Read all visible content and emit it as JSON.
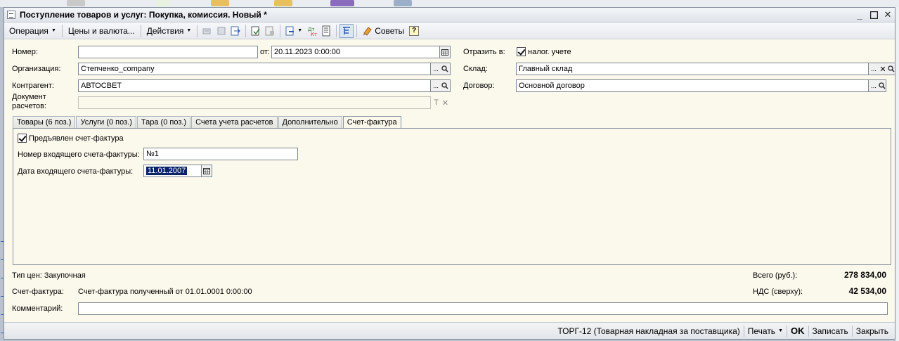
{
  "window": {
    "title": "Поступление товаров и услуг: Покупка, комиссия. Новый *"
  },
  "toolbar": {
    "operation_label": "Операция",
    "prices_label": "Цены и валюта...",
    "actions_label": "Действия",
    "tips_label": "Советы",
    "help_label": "?"
  },
  "header": {
    "number_label": "Номер:",
    "number_value": "",
    "from_label": "от:",
    "date_value": "20.11.2023  0:00:00",
    "reflect_label": "Отразить в:",
    "tax_label": "налог. учете",
    "org_label": "Организация:",
    "org_value": "Степченко_company",
    "warehouse_label": "Склад:",
    "warehouse_value": "Главный склад",
    "contractor_label": "Контрагент:",
    "contractor_value": "АВТОСВЕТ",
    "contract_label": "Договор:",
    "contract_value": "Основной договор",
    "settlement_doc_label_1": "Документ",
    "settlement_doc_label_2": "расчетов:",
    "settlement_doc_value": ""
  },
  "tabs": [
    {
      "label": "Товары (6 поз.)"
    },
    {
      "label": "Услуги (0 поз.)"
    },
    {
      "label": "Тара (0 поз.)"
    },
    {
      "label": "Счета учета расчетов"
    },
    {
      "label": "Дополнительно"
    },
    {
      "label": "Счет-фактура"
    }
  ],
  "invoice_tab": {
    "presented_label": "Предъявлен счет-фактура",
    "incoming_number_label": "Номер входящего счета-фактуры:",
    "incoming_number_value": "№1",
    "incoming_date_label": "Дата входящего счета-фактуры:",
    "incoming_date_value": "11.01.2007"
  },
  "footer": {
    "price_type_label": "Тип цен: Закупочная",
    "total_label": "Всего (руб.):",
    "total_value": "278 834,00",
    "invoice_label": "Счет-фактура:",
    "invoice_value": "Счет-фактура полученный  от 01.01.0001 0:00:00",
    "vat_label": "НДС (сверху):",
    "vat_value": "42 534,00",
    "comment_label": "Комментарий:",
    "comment_value": ""
  },
  "bottombar": {
    "torg_label": "ТОРГ-12 (Товарная накладная за поставщика)",
    "print_label": "Печать",
    "ok_label": "OK",
    "save_label": "Записать",
    "close_label": "Закрыть"
  },
  "colors": {
    "form_bg": "#fbf8ec",
    "selection": "#0a246a"
  }
}
